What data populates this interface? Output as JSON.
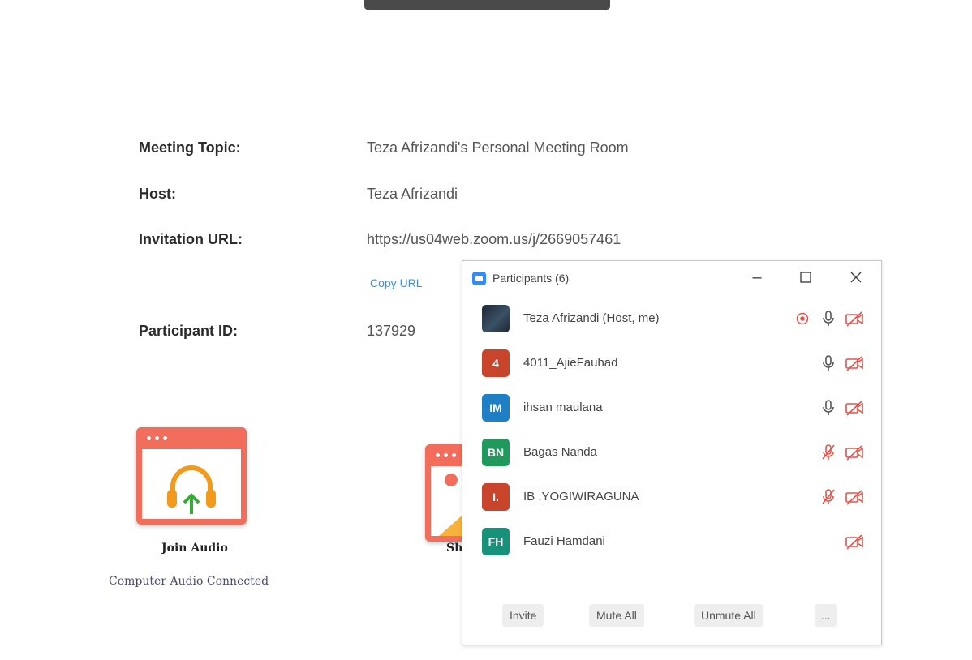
{
  "meeting": {
    "rows": [
      {
        "label": "Meeting Topic:",
        "value": "Teza Afrizandi's Personal Meeting Room"
      },
      {
        "label": "Host:",
        "value": "Teza Afrizandi"
      },
      {
        "label": "Invitation URL:",
        "value": "https://us04web.zoom.us/j/2669057461"
      },
      {
        "label": "Participant ID:",
        "value": "137929"
      }
    ],
    "copy_url": "Copy URL"
  },
  "tiles": {
    "join_audio": {
      "label": "Join Audio",
      "sub": "Computer Audio Connected"
    },
    "share_partial": "Sh"
  },
  "participants": {
    "title": "Participants (6)",
    "list": [
      {
        "name": "Teza Afrizandi (Host, me)",
        "initials": "",
        "avatar_color": "#2a3a4a",
        "recording": true,
        "mic": "on",
        "video": "off"
      },
      {
        "name": "4011_AjieFauhad",
        "initials": "4",
        "avatar_color": "#c8442a",
        "recording": false,
        "mic": "on",
        "video": "off"
      },
      {
        "name": "ihsan maulana",
        "initials": "IM",
        "avatar_color": "#1f7fc4",
        "recording": false,
        "mic": "on",
        "video": "off"
      },
      {
        "name": "Bagas Nanda",
        "initials": "BN",
        "avatar_color": "#1f9a5c",
        "recording": false,
        "mic": "muted",
        "video": "off"
      },
      {
        "name": "IB .YOGIWIRAGUNA",
        "initials": "I.",
        "avatar_color": "#c8442a",
        "recording": false,
        "mic": "muted",
        "video": "off"
      },
      {
        "name": "Fauzi Hamdani",
        "initials": "FH",
        "avatar_color": "#17927a",
        "recording": false,
        "mic": "none",
        "video": "off"
      }
    ],
    "buttons": {
      "invite": "Invite",
      "mute_all": "Mute All",
      "unmute_all": "Unmute All",
      "more": "..."
    }
  },
  "colors": {
    "accent_red": "#f26d5b",
    "link_blue": "#3d8fe0",
    "zoom_blue": "#2d8cff"
  }
}
